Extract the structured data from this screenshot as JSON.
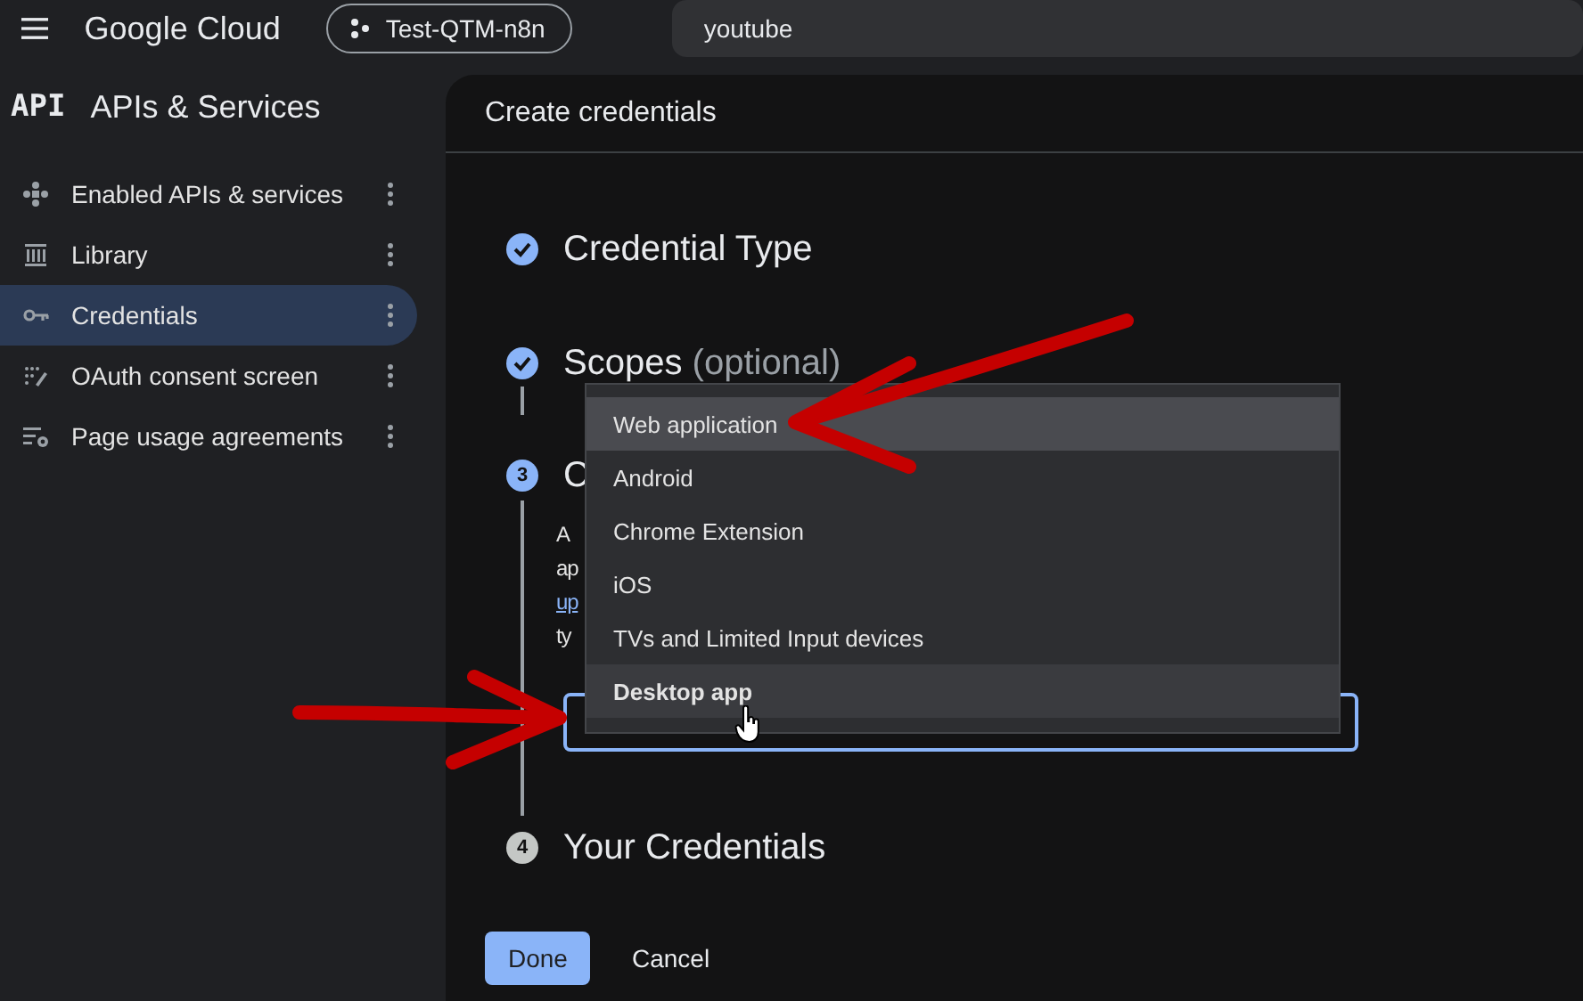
{
  "topbar": {
    "app_name": "Google Cloud",
    "project": "Test-QTM-n8n",
    "search": {
      "value": "youtube"
    }
  },
  "sidebar": {
    "logo": "API",
    "title": "APIs & Services",
    "items": [
      {
        "label": "Enabled APIs & services",
        "selected": false
      },
      {
        "label": "Library",
        "selected": false
      },
      {
        "label": "Credentials",
        "selected": true
      },
      {
        "label": "OAuth consent screen",
        "selected": false
      },
      {
        "label": "Page usage agreements",
        "selected": false
      }
    ]
  },
  "panel": {
    "title": "Create credentials",
    "steps": [
      {
        "kind": "done",
        "title": "Credential Type"
      },
      {
        "kind": "done",
        "title": "Scopes",
        "note": "(optional)"
      },
      {
        "kind": "current",
        "number": "3",
        "title": "C",
        "description": [
          {
            "text": "A"
          },
          {
            "text": "ap"
          },
          {
            "text": "up",
            "kind": "link"
          },
          {
            "text": "ty"
          }
        ],
        "field": {
          "focused": true
        }
      },
      {
        "kind": "pending",
        "number": "4",
        "title": "Your Credentials"
      }
    ],
    "dropdown": {
      "options": [
        {
          "label": "Web application",
          "highlighted": true,
          "selected": false
        },
        {
          "label": "Android",
          "highlighted": false,
          "selected": false
        },
        {
          "label": "Chrome Extension",
          "highlighted": false,
          "selected": false
        },
        {
          "label": "iOS",
          "highlighted": false,
          "selected": false
        },
        {
          "label": "TVs and Limited Input devices",
          "highlighted": false,
          "selected": false
        },
        {
          "label": "Desktop app",
          "highlighted": false,
          "selected": true
        }
      ]
    },
    "buttons": [
      {
        "label": "Done",
        "kind": "primary"
      },
      {
        "label": "Cancel",
        "kind": "text"
      }
    ]
  },
  "annotations": [
    {
      "kind": "arrow"
    },
    {
      "kind": "arrow"
    }
  ]
}
